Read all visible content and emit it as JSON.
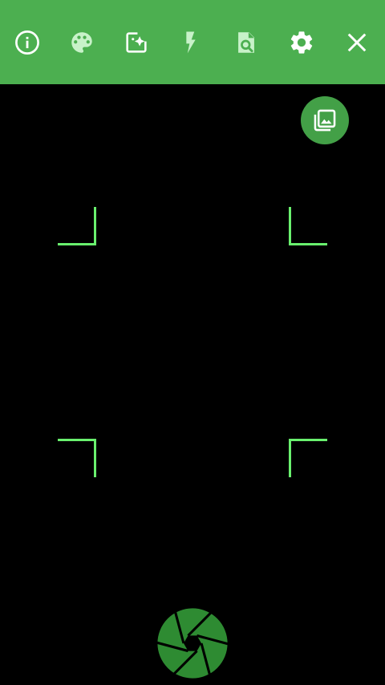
{
  "colors": {
    "toolbar_bg": "#4caf50",
    "icon_white": "#ffffff",
    "icon_light_green": "#c8f2c9",
    "fab_bg": "#43a047",
    "frame_green": "#69f06e",
    "shutter_green": "#2e8b32",
    "background": "#000000"
  },
  "toolbar": {
    "icons": [
      "info-icon",
      "palette-icon",
      "image-enhance-icon",
      "flash-icon",
      "document-search-icon",
      "settings-icon",
      "close-icon"
    ]
  },
  "gallery_button": {
    "icon": "photo-library-icon"
  },
  "viewfinder": {
    "corners": [
      "top-left",
      "top-right",
      "bottom-left",
      "bottom-right"
    ]
  },
  "shutter_button": {
    "icon": "camera-aperture-icon"
  }
}
